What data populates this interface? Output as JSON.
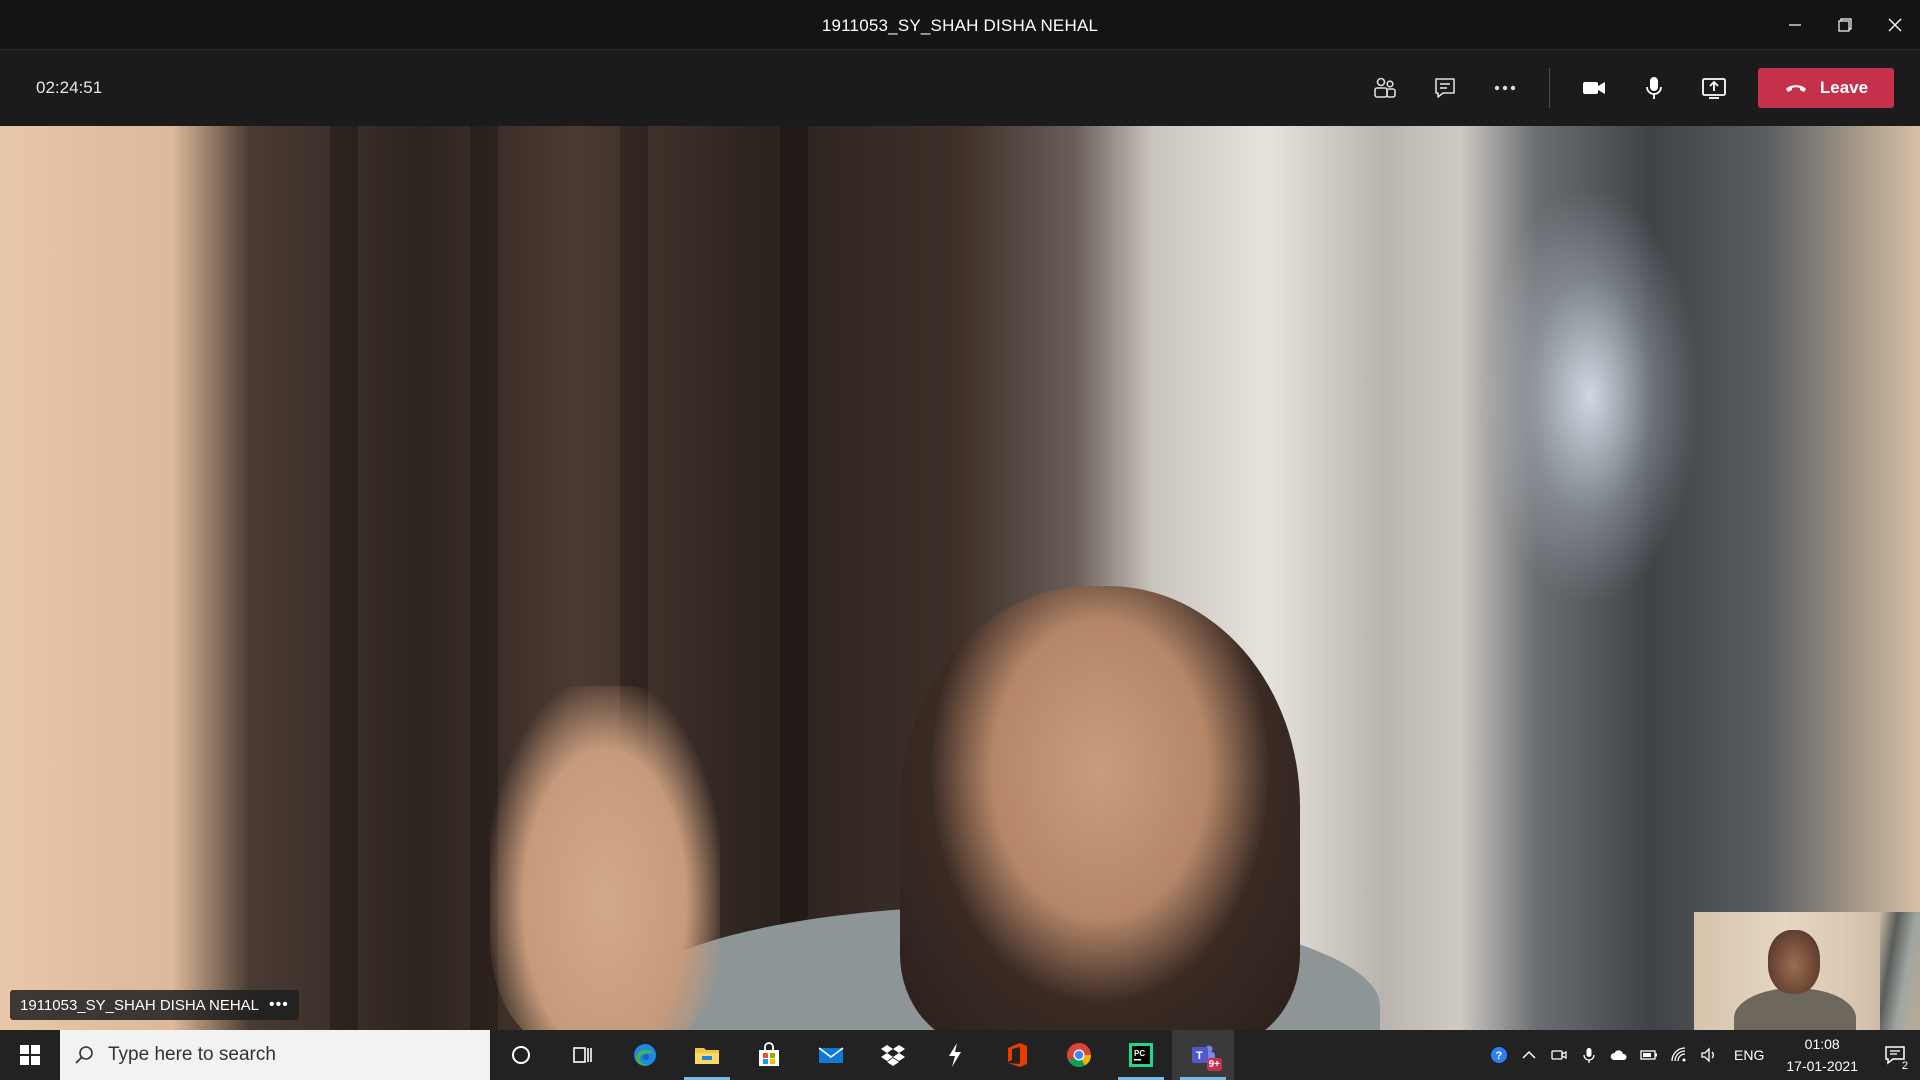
{
  "window": {
    "title": "1911053_SY_SHAH DISHA NEHAL"
  },
  "meeting": {
    "timer": "02:24:51",
    "leave_label": "Leave",
    "participant_label": "1911053_SY_SHAH DISHA NEHAL",
    "participant_more": "•••",
    "leave_color": "#c4314b"
  },
  "taskbar": {
    "search_placeholder": "Type here to search",
    "apps": [
      {
        "name": "cortana",
        "icon": "cortana-circle-icon"
      },
      {
        "name": "task-view",
        "icon": "task-view-icon"
      },
      {
        "name": "edge",
        "icon": "edge-icon"
      },
      {
        "name": "file-explorer",
        "icon": "folder-icon"
      },
      {
        "name": "microsoft-store",
        "icon": "store-bag-icon"
      },
      {
        "name": "mail",
        "icon": "mail-icon"
      },
      {
        "name": "dropbox",
        "icon": "dropbox-icon"
      },
      {
        "name": "app-lightning",
        "icon": "lightning-icon"
      },
      {
        "name": "office",
        "icon": "office-icon"
      },
      {
        "name": "chrome",
        "icon": "chrome-icon"
      },
      {
        "name": "pycharm",
        "icon": "pycharm-icon"
      },
      {
        "name": "teams",
        "icon": "teams-icon",
        "badge": "9+"
      }
    ],
    "tray": {
      "language": "ENG",
      "time": "01:08",
      "date": "17-01-2021",
      "notification_count": "2"
    }
  }
}
